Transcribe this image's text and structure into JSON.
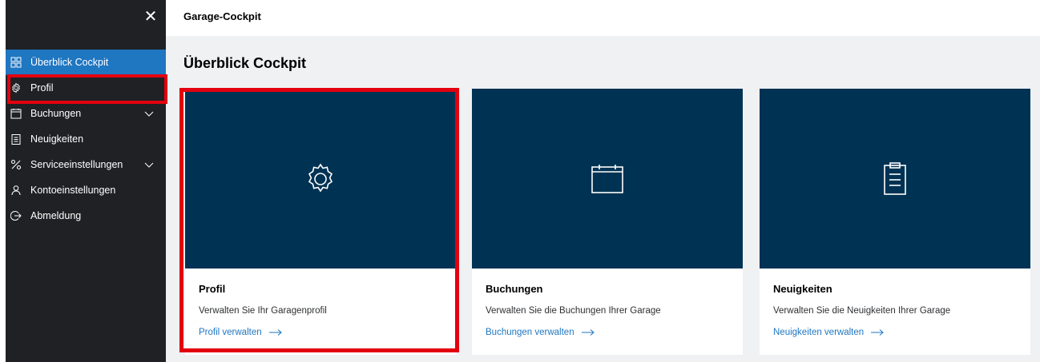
{
  "header": {
    "title": "Garage-Cockpit"
  },
  "sidebar": {
    "close_icon": "close-icon",
    "items": [
      {
        "label": "Überblick Cockpit",
        "icon": "grid-icon",
        "active": true
      },
      {
        "label": "Profil",
        "icon": "gear-icon"
      },
      {
        "label": "Buchungen",
        "icon": "calendar-icon",
        "expandable": true
      },
      {
        "label": "Neuigkeiten",
        "icon": "clipboard-icon"
      },
      {
        "label": "Serviceeinstellungen",
        "icon": "tools-icon",
        "expandable": true
      },
      {
        "label": "Kontoeinstellungen",
        "icon": "user-icon"
      },
      {
        "label": "Abmeldung",
        "icon": "logout-icon"
      }
    ]
  },
  "main": {
    "page_title": "Überblick Cockpit",
    "cards": [
      {
        "title": "Profil",
        "description": "Verwalten Sie Ihr Garagenprofil",
        "link": "Profil verwalten",
        "icon": "gear-icon"
      },
      {
        "title": "Buchungen",
        "description": "Verwalten Sie die Buchungen Ihrer Garage",
        "link": "Buchungen verwalten",
        "icon": "calendar-icon"
      },
      {
        "title": "Neuigkeiten",
        "description": "Verwalten Sie die Neuigkeiten Ihrer Garage",
        "link": "Neuigkeiten verwalten",
        "icon": "clipboard-icon"
      }
    ]
  },
  "colors": {
    "sidebar_bg": "#1f2124",
    "active_item": "#1f76c1",
    "card_hero": "#003253",
    "link": "#1f76c1",
    "highlight": "#e3000f",
    "main_bg": "#eff1f2"
  }
}
